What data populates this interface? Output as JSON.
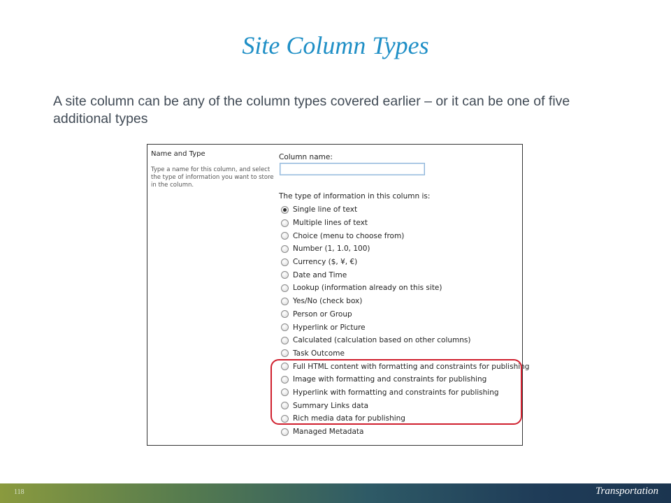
{
  "slide": {
    "title": "Site Column Types",
    "body": "A site column can be any of the column types covered earlier – or it can be one of five additional types"
  },
  "panel": {
    "heading": "Name and Type",
    "description": "Type a name for this column, and select the type of information you want to store in the column.",
    "column_name_label": "Column name:",
    "column_name_value": "",
    "type_label": "The type of information in this column is:",
    "options": [
      {
        "label": "Single line of text",
        "checked": true
      },
      {
        "label": "Multiple lines of text",
        "checked": false
      },
      {
        "label": "Choice (menu to choose from)",
        "checked": false
      },
      {
        "label": "Number (1, 1.0, 100)",
        "checked": false
      },
      {
        "label": "Currency ($, ¥, €)",
        "checked": false
      },
      {
        "label": "Date and Time",
        "checked": false
      },
      {
        "label": "Lookup (information already on this site)",
        "checked": false
      },
      {
        "label": "Yes/No (check box)",
        "checked": false
      },
      {
        "label": "Person or Group",
        "checked": false
      },
      {
        "label": "Hyperlink or Picture",
        "checked": false
      },
      {
        "label": "Calculated (calculation based on other columns)",
        "checked": false
      },
      {
        "label": "Task Outcome",
        "checked": false
      },
      {
        "label": "Full HTML content with formatting and constraints for publishing",
        "checked": false
      },
      {
        "label": "Image with formatting and constraints for publishing",
        "checked": false
      },
      {
        "label": "Hyperlink with formatting and constraints for publishing",
        "checked": false
      },
      {
        "label": "Summary Links data",
        "checked": false
      },
      {
        "label": "Rich media data for publishing",
        "checked": false
      },
      {
        "label": "Managed Metadata",
        "checked": false
      }
    ],
    "highlight_color": "#d0202e"
  },
  "footer": {
    "page_number": "118",
    "brand": "Transportation"
  }
}
